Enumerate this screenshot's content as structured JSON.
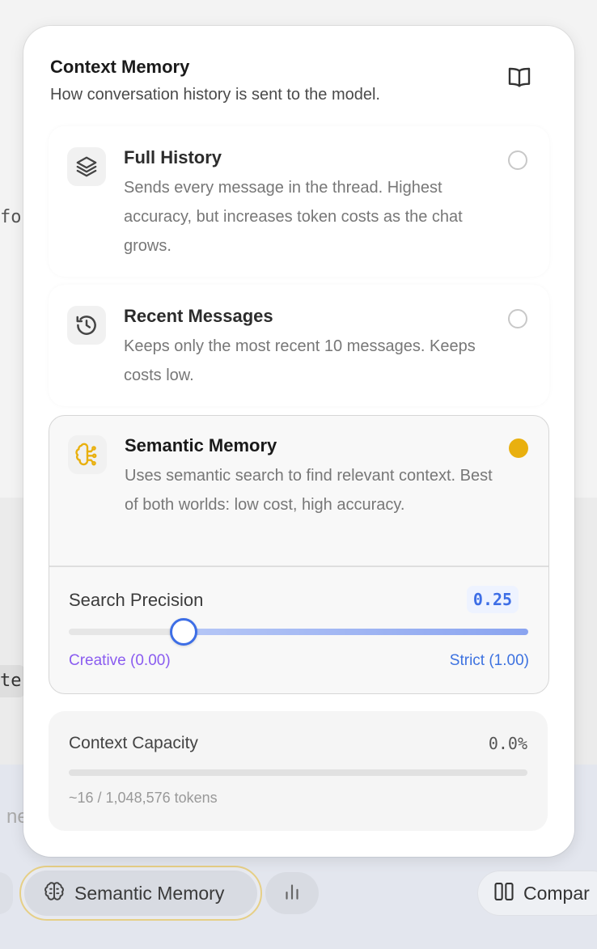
{
  "background": {
    "fragment_top": "fo",
    "fragment_mid": "te",
    "fragment_input": "ne"
  },
  "toolbar": {
    "memory_pill_label": "Semantic Memory",
    "compare_label": "Compar"
  },
  "popover": {
    "title": "Context Memory",
    "subtitle": "How conversation history is sent to the model.",
    "options": [
      {
        "title": "Full History",
        "description": "Sends every message in the thread. Highest accuracy, but increases token costs as the chat grows.",
        "selected": false
      },
      {
        "title": "Recent Messages",
        "description": "Keeps only the most recent 10 messages. Keeps costs low.",
        "selected": false
      },
      {
        "title": "Semantic Memory",
        "description": "Uses semantic search to find relevant context. Best of both worlds: low cost, high accuracy.",
        "selected": true
      }
    ],
    "precision": {
      "label": "Search Precision",
      "value": 0.25,
      "value_text": "0.25",
      "min_label": "Creative (0.00)",
      "max_label": "Strict (1.00)"
    },
    "capacity": {
      "label": "Context Capacity",
      "percent_text": "0.0%",
      "fraction": 0.0,
      "tokens_text": "~16 / 1,048,576 tokens"
    }
  },
  "colors": {
    "accent_gold": "#e9b00f",
    "accent_blue": "#3d6ee6",
    "accent_purple": "#8a5cf0"
  }
}
